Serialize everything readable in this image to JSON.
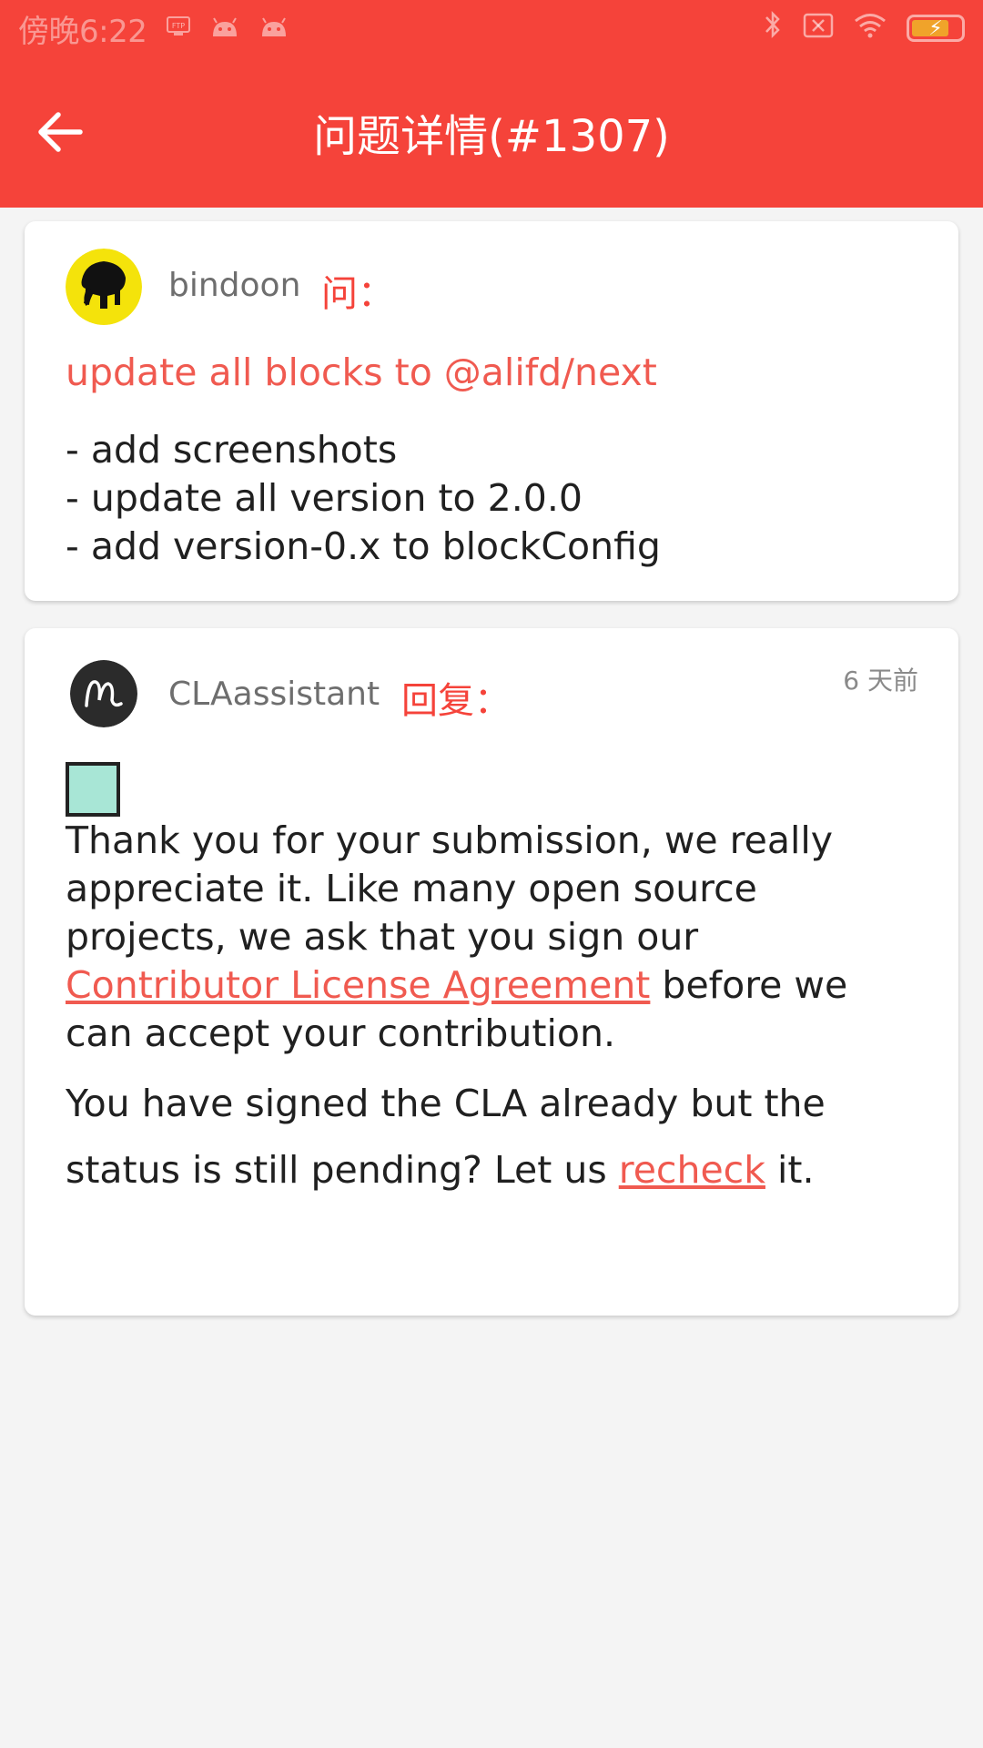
{
  "status_bar": {
    "time": "傍晚6:22",
    "icons_left": [
      "ftp-icon",
      "android-icon",
      "android-icon"
    ],
    "icons_right": [
      "bluetooth-icon",
      "no-sim-icon",
      "wifi-icon",
      "battery-charging-icon"
    ]
  },
  "toolbar": {
    "title": "问题详情(#1307)",
    "back_icon": "arrow-left-icon"
  },
  "question": {
    "username": "bindoon",
    "role_label": "问：",
    "title": "update all blocks to @alifd/next",
    "body_lines": [
      "- add screenshots",
      "- update all version to 2.0.0",
      "- add version-0.x to blockConfig"
    ]
  },
  "reply": {
    "username": "CLAassistant",
    "role_label": "回复：",
    "time_ago": "6 天前",
    "p1_before": "Thank you for your submission, we really appreciate it. Like many open source projects, we ask that you sign our ",
    "p1_link": "Contributor License Agreement",
    "p1_after": " before we can accept your contribution.",
    "p2_before": "You have signed the CLA already but the status is still pending? Let us ",
    "p2_link": "recheck",
    "p2_after": " it."
  },
  "colors": {
    "primary": "#f5433a",
    "link": "#f05a50",
    "background": "#f4f4f4"
  }
}
